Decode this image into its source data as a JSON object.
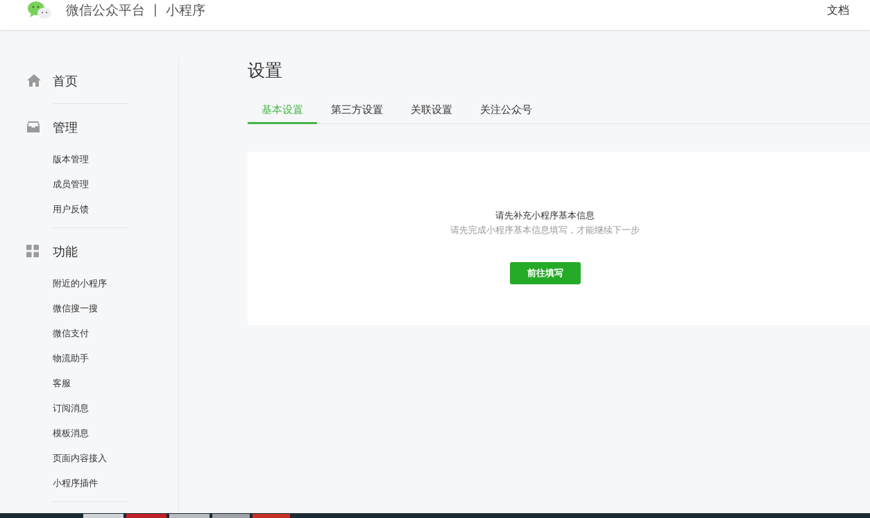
{
  "header": {
    "brand": "微信公众平台",
    "separator": "|",
    "product": "小程序",
    "docs_link": "文档"
  },
  "sidebar": {
    "sections": [
      {
        "kind": "home",
        "label": "首页"
      },
      {
        "kind": "inbox",
        "label": "管理",
        "items": [
          {
            "label": "版本管理"
          },
          {
            "label": "成员管理"
          },
          {
            "label": "用户反馈"
          }
        ]
      },
      {
        "kind": "grid",
        "label": "功能",
        "items": [
          {
            "label": "附近的小程序"
          },
          {
            "label": "微信搜一搜"
          },
          {
            "label": "微信支付"
          },
          {
            "label": "物流助手"
          },
          {
            "label": "客服"
          },
          {
            "label": "订阅消息"
          },
          {
            "label": "模板消息"
          },
          {
            "label": "页面内容接入"
          },
          {
            "label": "小程序插件"
          }
        ]
      }
    ]
  },
  "page": {
    "title": "设置",
    "tabs": [
      {
        "label": "基本设置",
        "selected": true
      },
      {
        "label": "第三方设置",
        "selected": false
      },
      {
        "label": "关联设置",
        "selected": false
      },
      {
        "label": "关注公众号",
        "selected": false
      }
    ],
    "notice": {
      "title": "请先补充小程序基本信息",
      "description": "请先完成小程序基本信息填写，才能继续下一步",
      "button": "前往填写"
    }
  }
}
